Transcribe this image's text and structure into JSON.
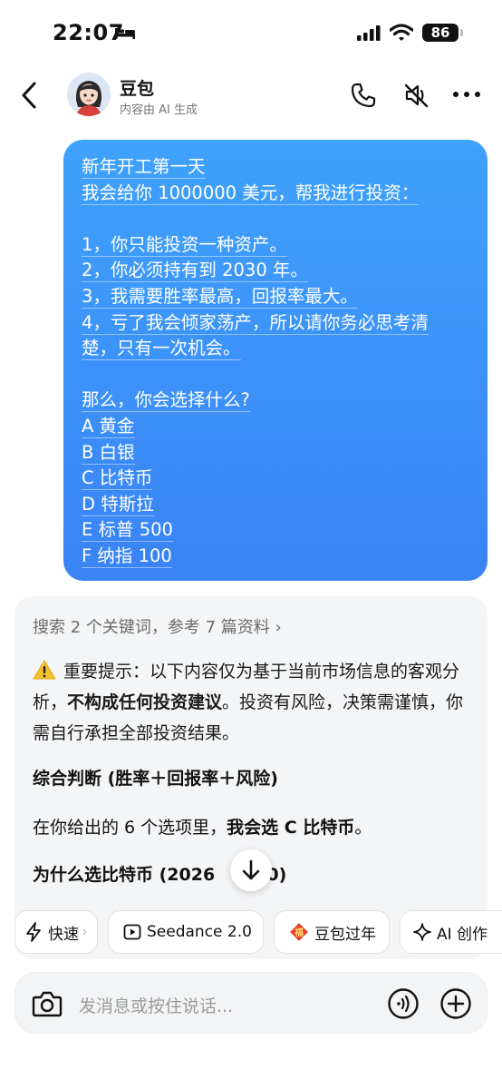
{
  "status_bar": {
    "time": "22:07",
    "battery": "86"
  },
  "header": {
    "name": "豆包",
    "subtitle": "内容由 AI 生成"
  },
  "user_message": {
    "lines": [
      "新年开工第一天",
      "我会给你 1000000 美元，帮我进行投资：",
      "",
      "1，你只能投资一种资产。",
      "2，你必须持有到 2030 年。",
      "3，我需要胜率最高，回报率最大。",
      "4，亏了我会倾家荡产，所以请你务必思考清",
      "楚，只有一次机会。",
      "",
      "那么，你会选择什么?",
      "A 黄金",
      "B 白银",
      "C 比特币",
      "D 特斯拉",
      "E 标普 500",
      "F 纳指 100"
    ]
  },
  "assistant": {
    "search_summary": "搜索 2 个关键词，参考 7 篇资料 ›",
    "warning_prefix": "重要提示：以下内容仅为基于当前市场信息的客观分析，",
    "warning_bold": "不构成任何投资建议",
    "warning_suffix": "。投资有风险，决策需谨慎，你需自行承担全部投资结果。",
    "section_title": "综合判断 (胜率＋回报率＋风险)",
    "choice_prefix": "在你给出的 6 个选项里，",
    "choice_bold": "我会选 C 比特币",
    "choice_suffix": "。",
    "why_left": "为什么选比特币 (2026",
    "why_right": "30)"
  },
  "chips": [
    {
      "label": "快速",
      "icon": "lightning-icon"
    },
    {
      "label": "Seedance 2.0",
      "icon": "play-icon"
    },
    {
      "label": "豆包过年",
      "icon": "fu-icon"
    },
    {
      "label": "AI 创作",
      "icon": "sparkle-icon"
    }
  ],
  "input": {
    "placeholder": "发消息或按住说话..."
  },
  "colors": {
    "bubble_top": "#3fa2fb",
    "bubble_bottom": "#3a83f5",
    "card_bg": "#f4f5f7"
  }
}
